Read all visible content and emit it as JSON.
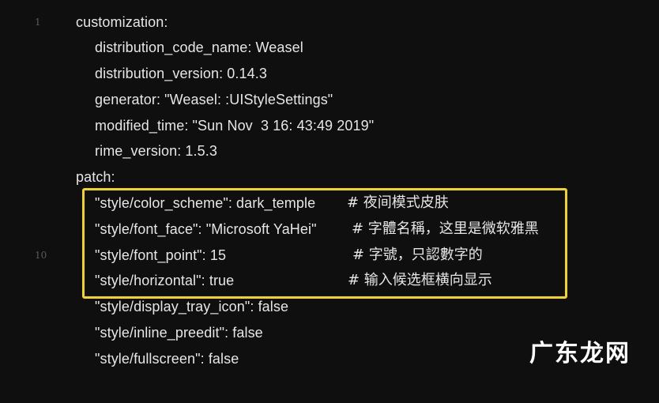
{
  "editor": {
    "lines": [
      {
        "number": "1",
        "code": "customization:"
      },
      {
        "number": "",
        "code": "distribution_code_name: Weasel"
      },
      {
        "number": "",
        "code": "distribution_version: 0.14.3"
      },
      {
        "number": "",
        "code": "generator: \"Weasel: :UIStyleSettings\""
      },
      {
        "number": "",
        "code": "modified_time: \"Sun Nov  3 16: 43:49 2019\""
      },
      {
        "number": "",
        "code": "rime_version: 1.5.3"
      },
      {
        "number": "",
        "code": "patch:"
      },
      {
        "number": "",
        "code": "\"style/color_scheme\": dark_temple",
        "comment": "# 夜间模式皮肤"
      },
      {
        "number": "",
        "code": "\"style/font_face\": \"Microsoft YaHei\"",
        "comment": "# 字體名稱，这里是微软雅黑"
      },
      {
        "number": "10",
        "code": "\"style/font_point\": 15",
        "comment": "# 字號，只認數字的"
      },
      {
        "number": "",
        "code": "\"style/horizontal\": true",
        "comment": "# 输入候选框横向显示"
      },
      {
        "number": "",
        "code": "\"style/display_tray_icon\": false"
      },
      {
        "number": "",
        "code": "\"style/inline_preedit\": false"
      },
      {
        "number": "",
        "code": "\"style/fullscreen\": false"
      }
    ]
  },
  "highlight": {
    "color": "#f1d51a"
  },
  "watermark": {
    "text": "广东龙网"
  }
}
